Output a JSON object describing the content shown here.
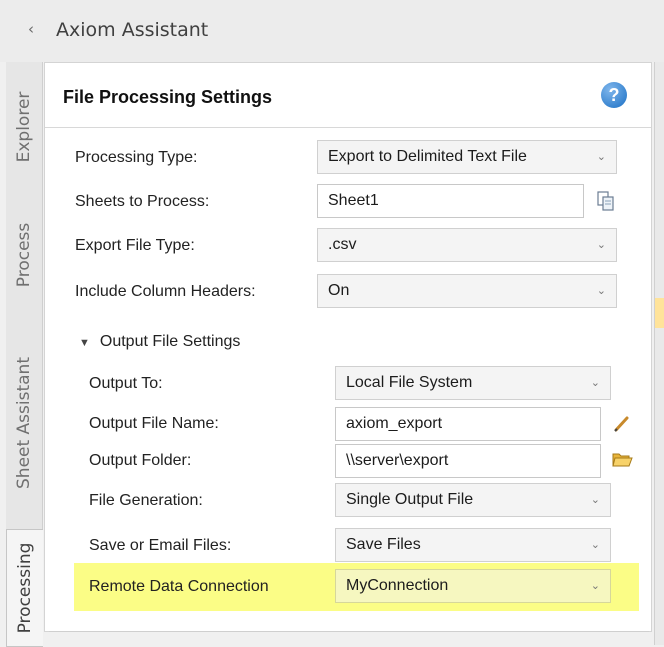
{
  "window": {
    "title": "Axiom Assistant",
    "collapse_glyph": "‹"
  },
  "side_tabs": [
    {
      "label": "Explorer",
      "active": false
    },
    {
      "label": "Process",
      "active": false
    },
    {
      "label": "Sheet Assistant",
      "active": false
    },
    {
      "label": "Processing",
      "active": true
    }
  ],
  "panel": {
    "title": "File Processing Settings",
    "help_glyph": "?"
  },
  "settings": {
    "processing_type": {
      "label": "Processing Type:",
      "value": "Export to Delimited Text File"
    },
    "sheets_to_process": {
      "label": "Sheets to Process:",
      "value": "Sheet1",
      "icon": "copy-sheets-icon"
    },
    "export_file_type": {
      "label": "Export File Type:",
      "value": ".csv"
    },
    "include_column_headers": {
      "label": "Include Column Headers:",
      "value": "On"
    }
  },
  "output_section": {
    "title": "Output File Settings",
    "expanded": true,
    "output_to": {
      "label": "Output To:",
      "value": "Local File System"
    },
    "output_file_name": {
      "label": "Output File Name:",
      "value": "axiom_export",
      "icon": "pencil-icon"
    },
    "output_folder": {
      "label": "Output Folder:",
      "value": "\\\\server\\export",
      "icon": "open-folder-icon"
    },
    "file_generation": {
      "label": "File Generation:",
      "value": "Single Output File"
    },
    "save_or_email": {
      "label": "Save or Email Files:",
      "value": "Save Files"
    },
    "remote_data_connection": {
      "label": "Remote Data Connection",
      "value": "MyConnection",
      "highlight_color": "#fbfd86"
    }
  },
  "colors": {
    "help_blue": "#1a6fc4",
    "highlight": "#fbfd86",
    "strip_highlight": "#ffe39a"
  }
}
